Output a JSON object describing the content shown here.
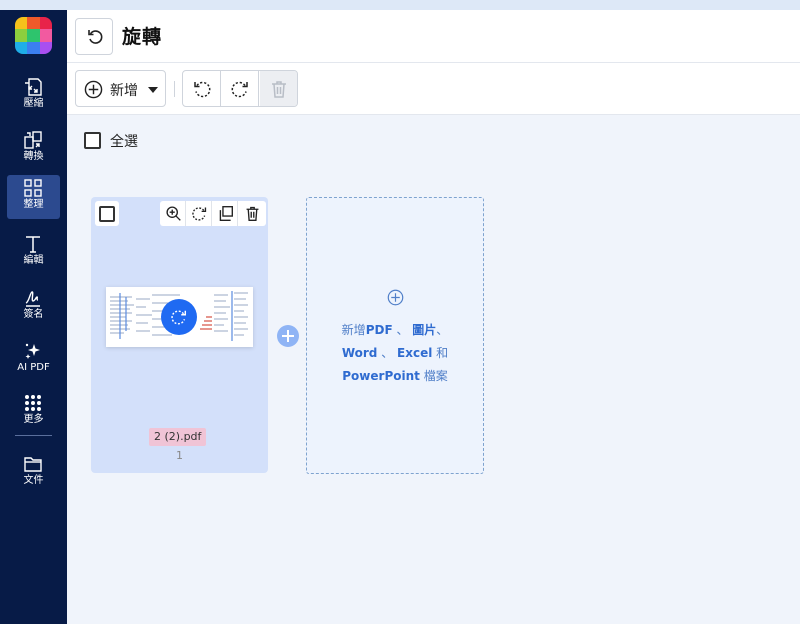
{
  "sidebar": {
    "items": [
      {
        "label": "壓縮",
        "icon": "compress-icon"
      },
      {
        "label": "轉換",
        "icon": "convert-icon"
      },
      {
        "label": "整理",
        "icon": "organize-icon"
      },
      {
        "label": "編輯",
        "icon": "edit-text-icon"
      },
      {
        "label": "簽名",
        "icon": "signature-icon"
      },
      {
        "label": "AI PDF",
        "icon": "ai-sparkle-icon"
      },
      {
        "label": "更多",
        "icon": "grid-dots-icon"
      },
      {
        "label": "文件",
        "icon": "folder-icon"
      }
    ],
    "active_index": 2
  },
  "header": {
    "title": "旋轉"
  },
  "toolbar": {
    "add_label": "新增"
  },
  "select_all_label": "全選",
  "file_card": {
    "filename": "2 (2).pdf",
    "page_number": "1"
  },
  "dropzone": {
    "prefix": "新增",
    "pdf": "PDF",
    "sep1": " 、 ",
    "images": "圖片",
    "sep2": "、",
    "word": "Word",
    "sep3": " 、 ",
    "excel": "Excel",
    "and": " 和",
    "powerpoint": "PowerPoint",
    "files": " 檔案"
  },
  "colors": {
    "sidebar_bg": "#071b47",
    "sidebar_active": "#2c4a8f",
    "accent_blue": "#1f6af2",
    "card_bg": "#d3e0fa",
    "filename_badge": "#f0c4d6",
    "dropzone_text": "#4f7ec8"
  }
}
